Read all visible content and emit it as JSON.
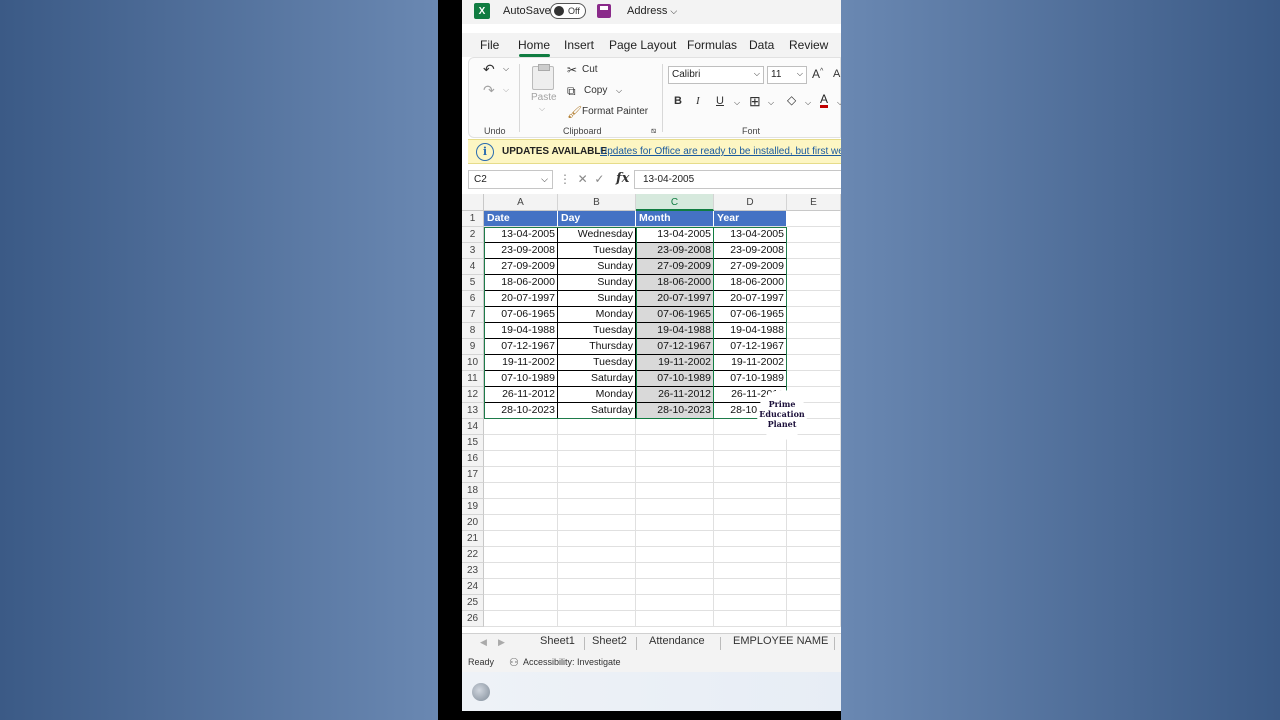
{
  "titlebar": {
    "autosave_label": "AutoSave",
    "autosave_state": "Off",
    "filename": "Address"
  },
  "menu_tabs": [
    "File",
    "Home",
    "Insert",
    "Page Layout",
    "Formulas",
    "Data",
    "Review"
  ],
  "active_tab": "Home",
  "ribbon": {
    "undo_group": "Undo",
    "paste_label": "Paste",
    "cut_label": "Cut",
    "copy_label": "Copy",
    "format_painter_label": "Format Painter",
    "clipboard_group": "Clipboard",
    "font_name": "Calibri",
    "font_size": "11",
    "bold": "B",
    "italic": "I",
    "underline": "U",
    "font_group": "Font"
  },
  "updates": {
    "head": "UPDATES AVAILABLE",
    "message": "Updates for Office are ready to be installed, but first we"
  },
  "formula_bar": {
    "name_box": "C2",
    "formula": "13-04-2005"
  },
  "columns": [
    "A",
    "B",
    "C",
    "D",
    "E"
  ],
  "selected_column": "C",
  "header_row": [
    "Date",
    "Day",
    "Month",
    "Year"
  ],
  "rows": [
    {
      "num": "2",
      "date": "13-04-2005",
      "day": "Wednesday",
      "month": "13-04-2005",
      "year": "13-04-2005"
    },
    {
      "num": "3",
      "date": "23-09-2008",
      "day": "Tuesday",
      "month": "23-09-2008",
      "year": "23-09-2008"
    },
    {
      "num": "4",
      "date": "27-09-2009",
      "day": "Sunday",
      "month": "27-09-2009",
      "year": "27-09-2009"
    },
    {
      "num": "5",
      "date": "18-06-2000",
      "day": "Sunday",
      "month": "18-06-2000",
      "year": "18-06-2000"
    },
    {
      "num": "6",
      "date": "20-07-1997",
      "day": "Sunday",
      "month": "20-07-1997",
      "year": "20-07-1997"
    },
    {
      "num": "7",
      "date": "07-06-1965",
      "day": "Monday",
      "month": "07-06-1965",
      "year": "07-06-1965"
    },
    {
      "num": "8",
      "date": "19-04-1988",
      "day": "Tuesday",
      "month": "19-04-1988",
      "year": "19-04-1988"
    },
    {
      "num": "9",
      "date": "07-12-1967",
      "day": "Thursday",
      "month": "07-12-1967",
      "year": "07-12-1967"
    },
    {
      "num": "10",
      "date": "19-11-2002",
      "day": "Tuesday",
      "month": "19-11-2002",
      "year": "19-11-2002"
    },
    {
      "num": "11",
      "date": "07-10-1989",
      "day": "Saturday",
      "month": "07-10-1989",
      "year": "07-10-1989"
    },
    {
      "num": "12",
      "date": "26-11-2012",
      "day": "Monday",
      "month": "26-11-2012",
      "year": "26-11-2012"
    },
    {
      "num": "13",
      "date": "28-10-2023",
      "day": "Saturday",
      "month": "28-10-2023",
      "year": "28-10-2023"
    }
  ],
  "empty_row_numbers": [
    "14",
    "15",
    "16",
    "17",
    "18",
    "19",
    "20",
    "21",
    "22",
    "23",
    "24",
    "25",
    "26"
  ],
  "watermark": [
    "Prime",
    "Education",
    "Planet"
  ],
  "sheet_tabs": [
    "Sheet1",
    "Sheet2",
    "Attendance",
    "EMPLOYEE NAME"
  ],
  "status": {
    "ready": "Ready",
    "accessibility": "Accessibility: Investigate"
  },
  "colors": {
    "excel_green": "#107c41",
    "header_blue": "#4472c4",
    "selection_grey": "#d9d9d9",
    "updates_yellow": "#fdf6c3"
  }
}
